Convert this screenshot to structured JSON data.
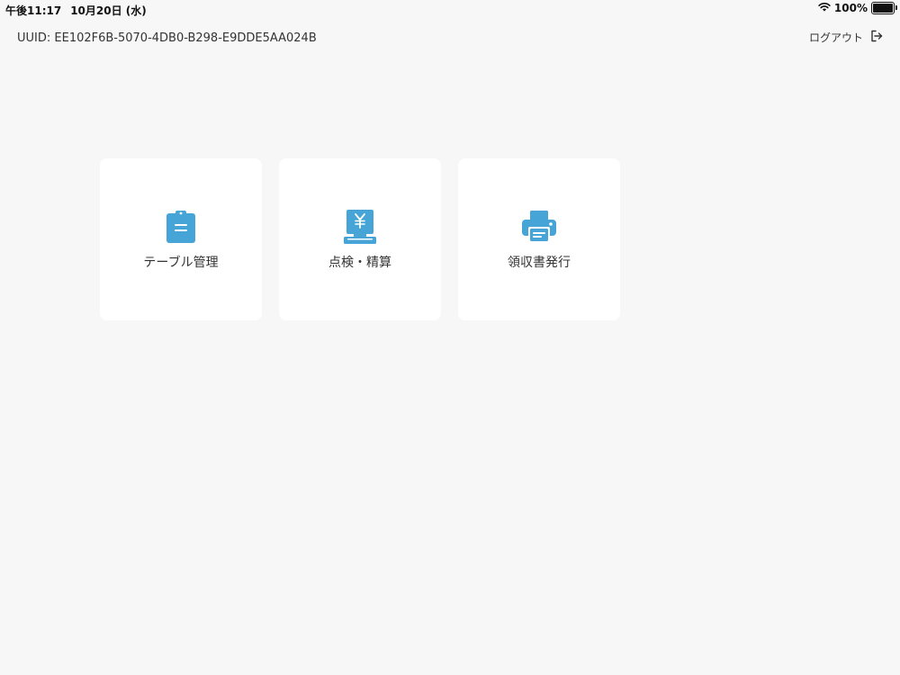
{
  "status_bar": {
    "time": "午後11:17",
    "date": "10月20日 (水)",
    "battery_text": "100%",
    "battery_level": 1.0
  },
  "header": {
    "uuid": "UUID: EE102F6B-5070-4DB0-B298-E9DDE5AA024B",
    "logout_label": "ログアウト"
  },
  "tiles": [
    {
      "label": "テーブル管理",
      "icon": "clipboard-icon"
    },
    {
      "label": "点検・精算",
      "icon": "register-yen-icon"
    },
    {
      "label": "領収書発行",
      "icon": "printer-icon"
    }
  ],
  "colors": {
    "accent": "#46a5d6",
    "background": "#f7f7f7",
    "tile": "#ffffff",
    "text": "#333333"
  }
}
